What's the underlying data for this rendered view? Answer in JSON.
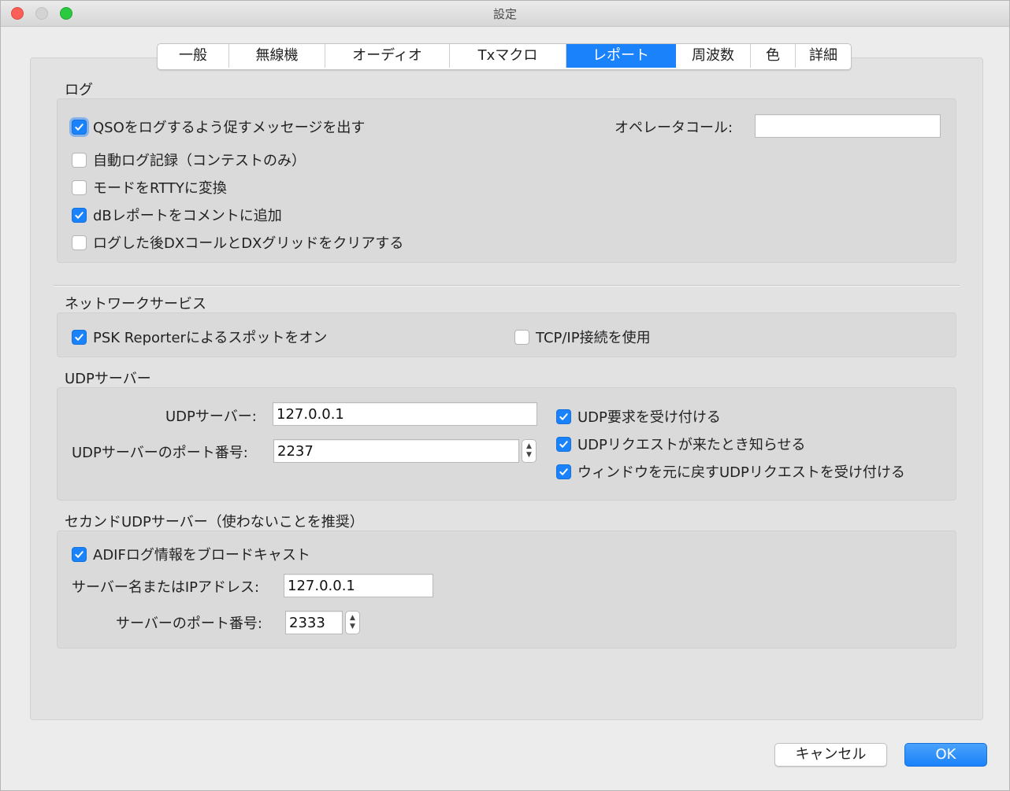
{
  "window": {
    "title": "設定"
  },
  "tabs": [
    {
      "label": "一般"
    },
    {
      "label": "無線機"
    },
    {
      "label": "オーディオ"
    },
    {
      "label": "Txマクロ"
    },
    {
      "label": "レポート",
      "active": true
    },
    {
      "label": "周波数"
    },
    {
      "label": "色"
    },
    {
      "label": "詳細"
    }
  ],
  "log": {
    "title": "ログ",
    "prompt_qso": {
      "label": "QSOをログするよう促すメッセージを出す",
      "checked": true
    },
    "auto_log": {
      "label": "自動ログ記録（コンテストのみ）",
      "checked": false
    },
    "mode_rtty": {
      "label": "モードをRTTYに変換",
      "checked": false
    },
    "db_report": {
      "label": "dBレポートをコメントに追加",
      "checked": true
    },
    "clear_dx": {
      "label": "ログした後DXコールとDXグリッドをクリアする",
      "checked": false
    },
    "operator_call_label": "オペレータコール:",
    "operator_call_value": ""
  },
  "network": {
    "title": "ネットワークサービス",
    "psk_reporter": {
      "label": "PSK Reporterによるスポットをオン",
      "checked": true
    },
    "tcp_ip": {
      "label": "TCP/IP接続を使用",
      "checked": false
    }
  },
  "udp": {
    "title": "UDPサーバー",
    "server_label": "UDPサーバー:",
    "server_value": "127.0.0.1",
    "port_label": "UDPサーバーのポート番号:",
    "port_value": "2237",
    "accept_requests": {
      "label": "UDP要求を受け付ける",
      "checked": true
    },
    "notify_requests": {
      "label": "UDPリクエストが来たとき知らせる",
      "checked": true
    },
    "restore_window": {
      "label": "ウィンドウを元に戻すUDPリクエストを受け付ける",
      "checked": true
    }
  },
  "secondary_udp": {
    "title": "セカンドUDPサーバー（使わないことを推奨）",
    "adif_broadcast": {
      "label": "ADIFログ情報をブロードキャスト",
      "checked": true
    },
    "server_label": "サーバー名またはIPアドレス:",
    "server_value": "127.0.0.1",
    "port_label": "サーバーのポート番号:",
    "port_value": "2333"
  },
  "buttons": {
    "cancel": "キャンセル",
    "ok": "OK"
  },
  "colors": {
    "accent": "#1a82fb",
    "close": "#fc5f57",
    "maximize": "#2ac940"
  },
  "icons": {
    "check": "checkmark-icon",
    "stepper": "up-down-arrows-icon"
  }
}
